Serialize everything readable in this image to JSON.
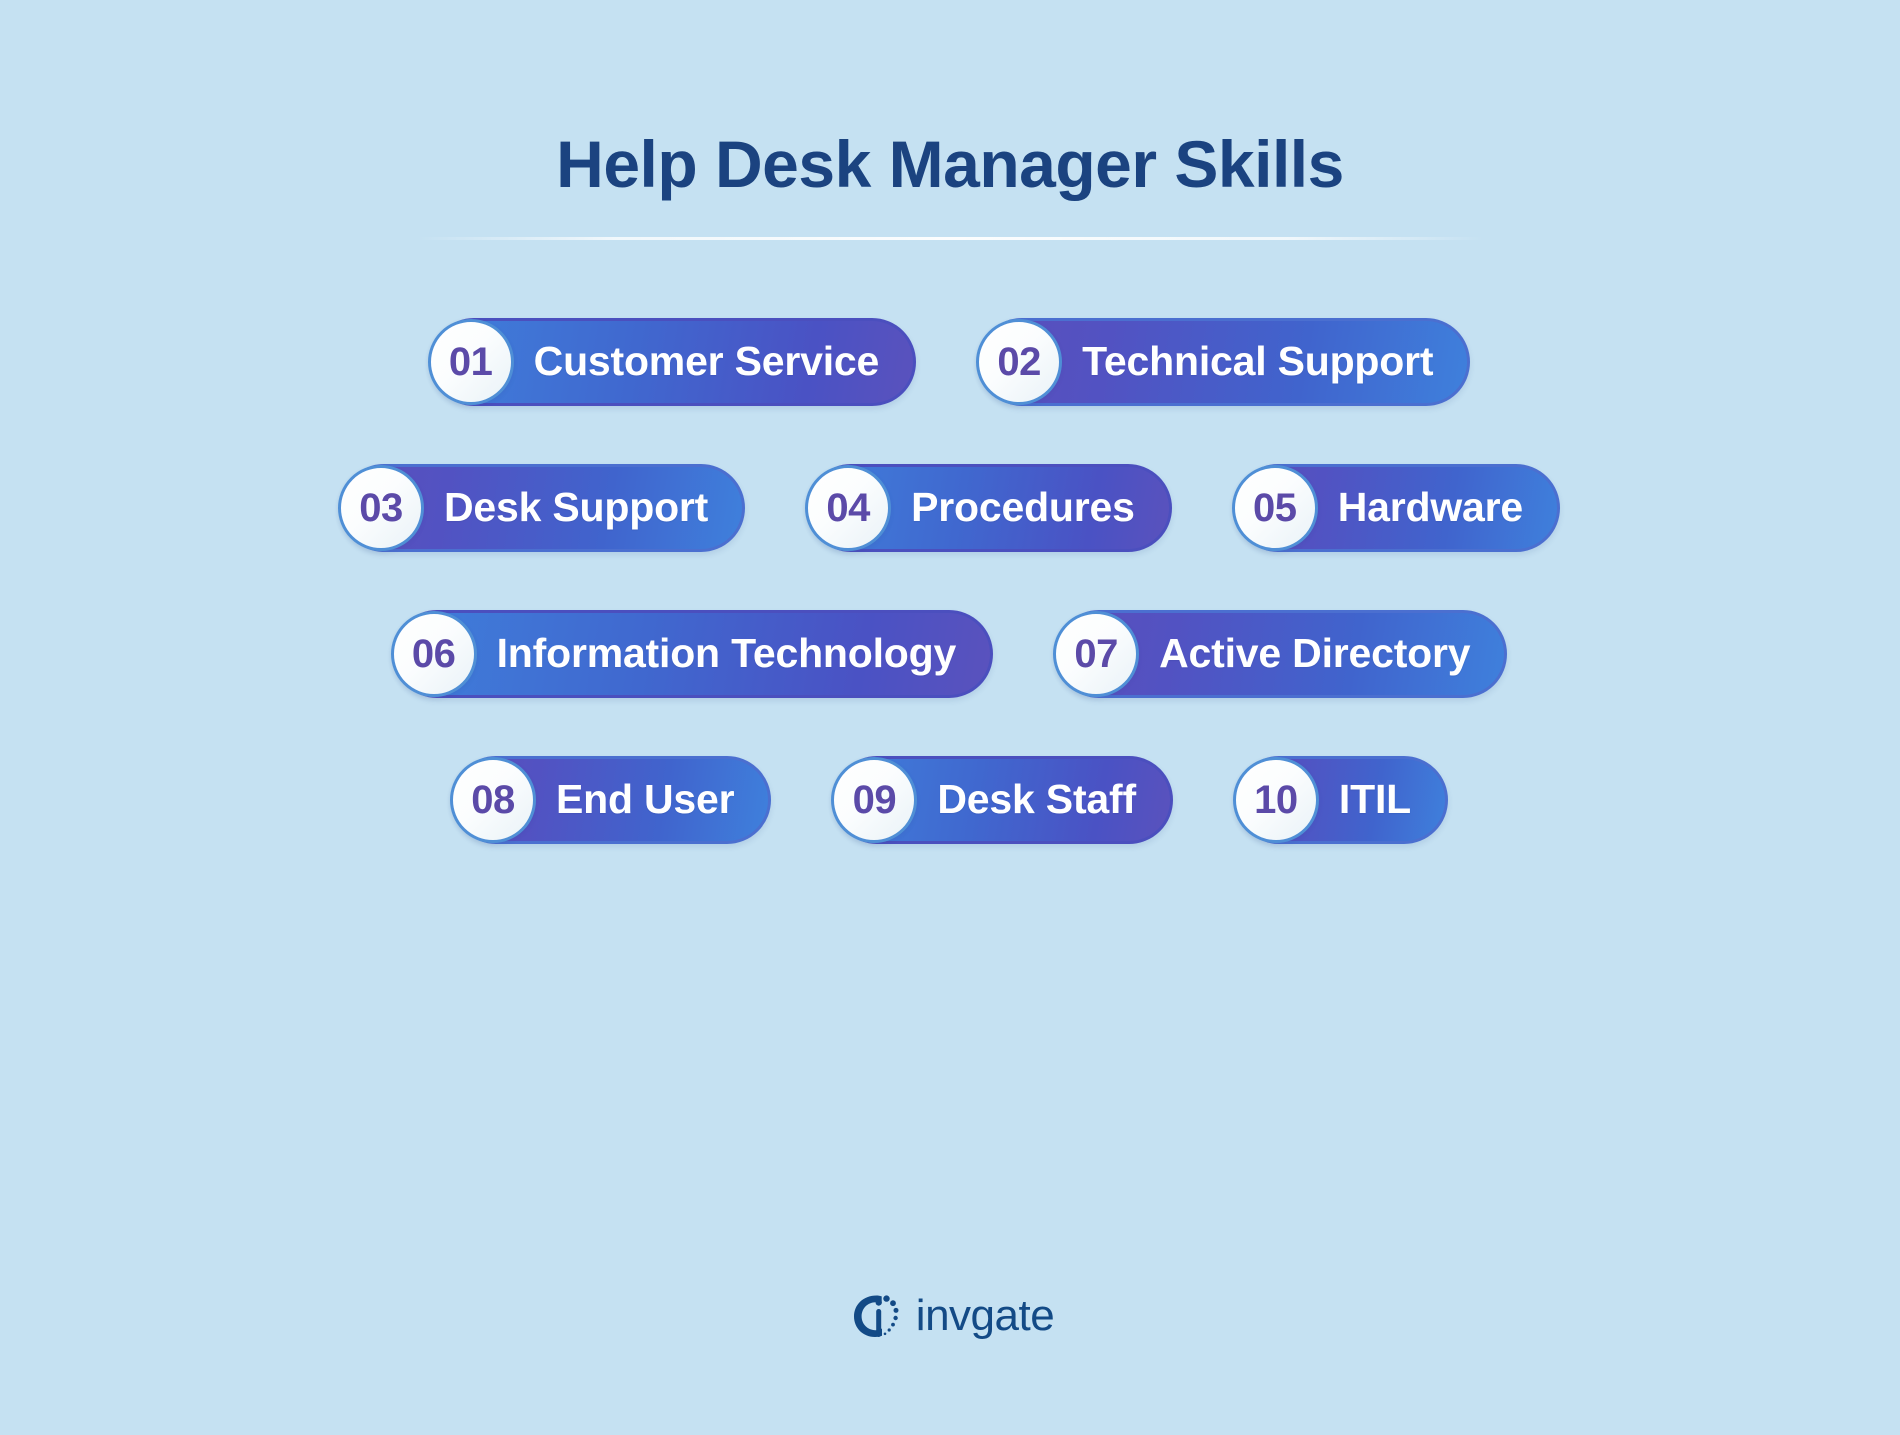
{
  "page": {
    "background_color": "#c5e1f2",
    "title": "Help Desk Manager Skills",
    "title_color": "#1b4380"
  },
  "colors": {
    "accent_blue": "#3f80dc",
    "accent_purple": "#5b4fbb",
    "badge_number": "#5b4aa8",
    "badge_border": "#4f8fd6",
    "label_text": "#ffffff",
    "logo_navy": "#134a86"
  },
  "skills": {
    "rows": [
      {
        "items": [
          {
            "number": "01",
            "label": "Customer Service",
            "gradient": "blue-to-purple"
          },
          {
            "number": "02",
            "label": "Technical Support",
            "gradient": "purple-to-blue"
          }
        ]
      },
      {
        "items": [
          {
            "number": "03",
            "label": "Desk Support",
            "gradient": "purple-to-blue"
          },
          {
            "number": "04",
            "label": "Procedures",
            "gradient": "blue-to-purple"
          },
          {
            "number": "05",
            "label": "Hardware",
            "gradient": "purple-to-blue"
          }
        ]
      },
      {
        "items": [
          {
            "number": "06",
            "label": "Information Technology",
            "gradient": "blue-to-purple"
          },
          {
            "number": "07",
            "label": "Active Directory",
            "gradient": "purple-to-blue"
          }
        ]
      },
      {
        "items": [
          {
            "number": "08",
            "label": "End User",
            "gradient": "purple-to-blue"
          },
          {
            "number": "09",
            "label": "Desk Staff",
            "gradient": "blue-to-purple"
          },
          {
            "number": "10",
            "label": "ITIL",
            "gradient": "purple-to-blue"
          }
        ]
      }
    ]
  },
  "footer": {
    "logo_text": "invgate",
    "logo_icon": "invgate-logo-icon"
  }
}
